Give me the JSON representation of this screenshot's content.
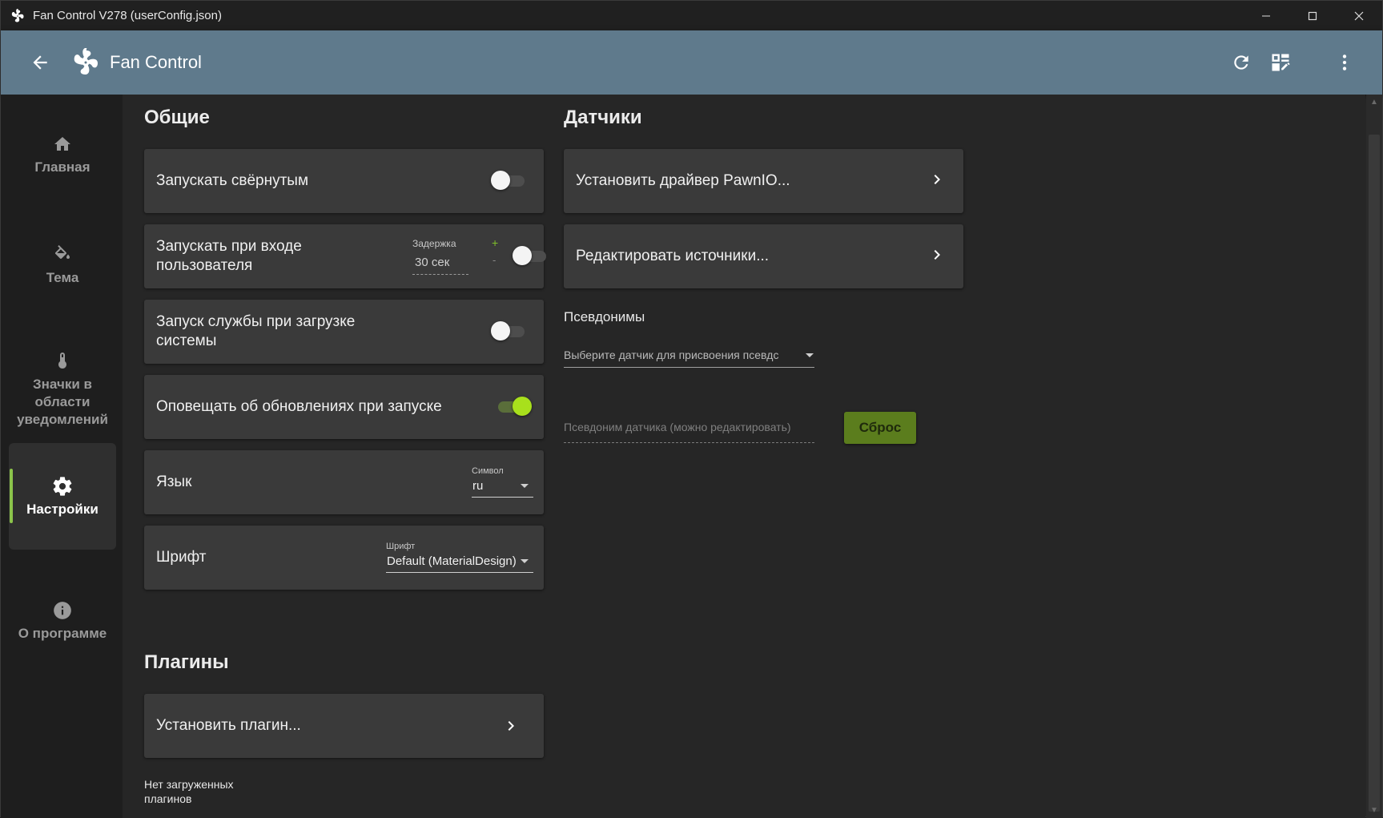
{
  "window": {
    "title": "Fan Control V278 (userConfig.json)"
  },
  "header": {
    "app_title": "Fan Control",
    "icons": [
      "back-arrow-icon",
      "fan-icon",
      "refresh-icon",
      "dashboard-edit-icon",
      "more-vert-icon"
    ]
  },
  "sidebar": {
    "items": [
      {
        "label": "Главная",
        "icon": "home-icon"
      },
      {
        "label": "Тема",
        "icon": "paint-bucket-icon"
      },
      {
        "label": "Значки в области уведомлений",
        "icon": "thermometer-icon"
      },
      {
        "label": "Настройки",
        "icon": "gear-icon",
        "active": true
      },
      {
        "label": "О программе",
        "icon": "info-icon"
      }
    ]
  },
  "general": {
    "title": "Общие",
    "start_minimized": {
      "label": "Запускать свёрнутым",
      "on": false
    },
    "start_on_login": {
      "label": "Запускать при входе пользователя",
      "delay_caption": "Задержка",
      "delay_value": "30 сек",
      "plus": "+",
      "minus": "-",
      "on": false
    },
    "start_service": {
      "label": "Запуск службы при загрузке системы",
      "on": false
    },
    "notify_updates": {
      "label": "Оповещать об обновлениях при запуске",
      "on": true
    },
    "language": {
      "label": "Язык",
      "caption": "Символ",
      "value": "ru"
    },
    "font": {
      "label": "Шрифт",
      "caption": "Шрифт",
      "value": "Default (MaterialDesign)"
    }
  },
  "plugins": {
    "title": "Плагины",
    "install_label": "Установить плагин...",
    "empty_text": "Нет загруженных плагинов"
  },
  "sensors": {
    "title": "Датчики",
    "install_driver_label": "Установить драйвер PawnIO...",
    "edit_sources_label": "Редактировать источники...",
    "aliases_title": "Псевдонимы",
    "sensor_select_placeholder": "Выберите датчик для присвоения псевдс",
    "alias_placeholder": "Псевдоним датчика (можно редактировать)",
    "reset_label": "Сброс"
  },
  "colors": {
    "accent": "#a8e01c",
    "header_bg": "#5f7a8c",
    "reset_bg": "#5b7d1d"
  }
}
